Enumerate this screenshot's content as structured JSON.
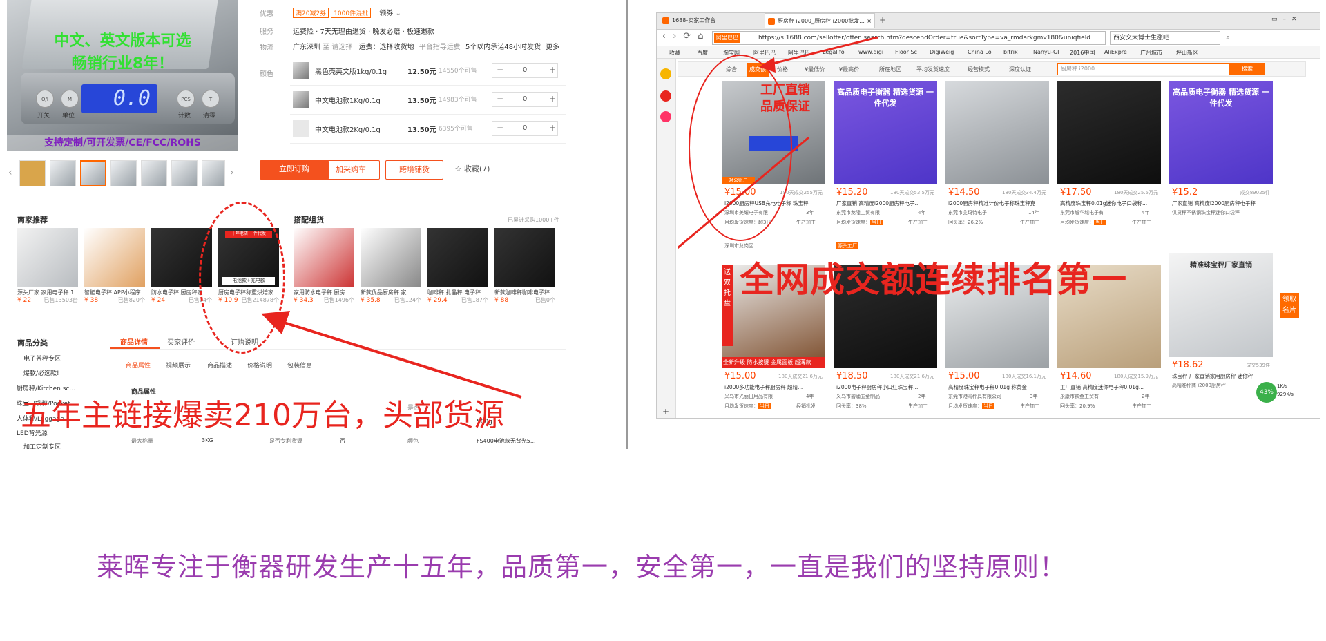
{
  "left_panel": {
    "image_overlay_line1": "中文、英文版本可选",
    "image_overlay_line2": "畅销行业8年！",
    "image_display": "0.0",
    "image_buttons": [
      "开关",
      "单位",
      "计数",
      "清零"
    ],
    "image_button_caps": [
      "O/I",
      "M",
      "PCS",
      "T"
    ],
    "image_bottom_banner": "支持定制/可开发票/CE/FCC/ROHS",
    "offer": {
      "promo_label": "优惠",
      "promo_tags": [
        "满20减2券",
        "1000件混批"
      ],
      "promo_more": "领券",
      "service_label": "服务",
      "service_value": "运费险 · 7天无理由退货 · 晚发必赔 · 极速退款",
      "logistics_label": "物流",
      "logistics_from": "广东深圳",
      "logistics_to": "至 请选择",
      "logistics_freight": "运费：选择收货地",
      "logistics_note": "平台指导运费",
      "logistics_ship": "5个以内承诺48小时发货",
      "logistics_more": "更多",
      "color_label": "颜色"
    },
    "skus": [
      {
        "name": "黑色壳英文版1kg/0.1g",
        "price": "12.50元",
        "stock": "14550个可售",
        "qty": "0"
      },
      {
        "name": "中文电池款1Kg/0.1g",
        "price": "13.50元",
        "stock": "14983个可售",
        "qty": "0"
      },
      {
        "name": "中文电池款2Kg/0.1g",
        "price": "13.50元",
        "stock": "6395个可售",
        "qty": "0"
      }
    ],
    "stepper_minus": "−",
    "stepper_plus": "+",
    "buttons": {
      "order": "立即订购",
      "cart": "加采购车",
      "crossborder": "跨境铺货",
      "fav": "☆ 收藏(7)"
    },
    "merchant_rec_title": "商家推荐",
    "combo_title": "搭配组货",
    "combo_note": "已累计采购1000+件",
    "products": [
      {
        "name": "源头厂家 家用电子秤 1...",
        "price": "¥ 22",
        "sold": "已售13503台"
      },
      {
        "name": "智能电子秤 APP小程序...",
        "price": "¥ 38",
        "sold": "已售820个"
      },
      {
        "name": "防水电子秤 厨房秤家...",
        "price": "¥ 24",
        "sold": "已售24个"
      },
      {
        "name": "厨房电子秤称重烘焙家...",
        "price": "¥ 10.9",
        "sold": "已售214878个"
      },
      {
        "name": "家用防水电子秤 厨房...",
        "price": "¥ 34.3",
        "sold": "已售1496个"
      },
      {
        "name": "新款优品厨房秤 家...",
        "price": "¥ 35.8",
        "sold": "已售124个"
      },
      {
        "name": "咖啡秤 扎晶秤 电子秤...",
        "price": "¥ 29.4",
        "sold": "已售187个"
      },
      {
        "name": "新款咖啡秤咖啡电子秤...",
        "price": "¥ 88",
        "sold": "已售0个"
      }
    ],
    "product_badge": "电池款+充电款",
    "product_badge2": "十年老店 一件代发",
    "category_title": "商品分类",
    "categories": [
      "电子茶秤专区",
      "爆款/必选款!",
      "厨房秤/Kitchen sc...",
      "珠宝口袋秤/Pocket...",
      "人体秤/Luggage...",
      "LED背光源",
      "加工定制专区"
    ],
    "detail_tabs": [
      "商品详情",
      "买家评价",
      "订购说明"
    ],
    "sub_tabs": [
      "商品属性",
      "视频展示",
      "商品描述",
      "价格说明",
      "包装信息"
    ],
    "attr_title": "商品属性",
    "attrs": [
      {
        "k": "最大称量",
        "v": "3KG"
      },
      {
        "k": "是否专利货源",
        "v": "否"
      },
      {
        "k": "颜色",
        "v": "FS400电池款无背光5..."
      }
    ],
    "attr_fragment": "是否",
    "attr_fragment2": "500g",
    "overlay_caption": "五年主链接爆卖210万台，头部货源"
  },
  "browser": {
    "tabs": [
      "1688-卖家工作台",
      "厨房秤 i2000_厨房秤 i2000批发..."
    ],
    "url": "https://s.1688.com/selloffer/offer_search.htm?descendOrder=true&sortType=va_rmdarkgmv180&uniqfield",
    "address_badge": "阿里巴巴",
    "search_engine_text": "西安交大博士生涨吧",
    "bookmarks": [
      "收藏",
      "百度",
      "淘宝网",
      "阿里巴巴",
      "阿里巴巴",
      "Legal fo",
      "www.digi",
      "Floor Sc",
      "DigiWeig",
      "China Lo",
      "bitrix",
      "Nanyu-GI",
      "2016中国",
      "AliExpre",
      "广州城市",
      "坪山新区"
    ],
    "filters": [
      "综合",
      "成交额",
      "价格",
      "¥最低价",
      "¥最高价",
      "所在地区",
      "平均发货速度",
      "经营模式",
      "深度认证"
    ],
    "search_value": "厨房秤 i2000",
    "search_button": "搜索",
    "overlay_factory1": "工厂直销",
    "overlay_factory2": "品质保证",
    "overlay_rank": "全网成交额连续排名第一",
    "side_labels": [
      "领取",
      "名片"
    ],
    "speed": "43%",
    "speed_up": "1K/s",
    "speed_down": "929K/s",
    "cards": [
      {
        "price": "¥15.00",
        "sold": "180天成交255万元",
        "title": "i2000厨房秤USB充电电子称 珠宝秤",
        "co": "深圳市美耀电子有限",
        "yrs": "3年",
        "speed": "超3日",
        "mode": "生产加工",
        "head": "",
        "tag": "对公账户",
        "region": "深圳市龙岗区"
      },
      {
        "price": "¥15.20",
        "sold": "180天成交53.5万元",
        "title": "厂家直销 高精度i2000厨房秤电子...",
        "co": "东莞市龙隆工贸有限",
        "yrs": "4年",
        "speed": "当日",
        "mode": "生产加工",
        "head": "高品质电子衡器 精选货源 一件代发",
        "tag": "",
        "region": "源头工厂"
      },
      {
        "price": "¥14.50",
        "sold": "180天成交34.4万元",
        "title": "i2000厨房秤精准计价电子称珠宝秤克",
        "co": "东莞市艾玛特电子",
        "yrs": "14年",
        "speed": "26.2%",
        "mode": "生产加工",
        "head": "",
        "tag": "",
        "region": ""
      },
      {
        "price": "¥17.50",
        "sold": "180天成交25.5万元",
        "title": "高精度珠宝秤0.01g迷你电子口袋称...",
        "co": "东莞市城华城电子有",
        "yrs": "4年",
        "speed": "当日",
        "mode": "生产加工",
        "head": "",
        "tag": "",
        "region": ""
      },
      {
        "price": "¥15.2",
        "sold": "成交89025件",
        "title": "厂家直销 高精度i2000厨房秤电子秤",
        "co": "供货秤不锈钢珠宝秤迷你口袋秤",
        "yrs": "",
        "speed": "",
        "mode": "",
        "head": "高品质电子衡器 精选货源 一件代发",
        "tag": "",
        "region": ""
      },
      {
        "price": "¥15.00",
        "sold": "180天成交21.6万元",
        "title": "i2000多功能电子秤厨房秤 超精...",
        "co": "义乌市光丽日用品有限",
        "yrs": "4年",
        "speed": "当日",
        "mode": "经销批发",
        "head": "",
        "tag": "",
        "region": ""
      },
      {
        "price": "¥18.50",
        "sold": "180天成交21.6万元",
        "title": "i2000电子秤厨房秤小口红珠宝秤...",
        "co": "义乌市碧涌五金制品",
        "yrs": "2年",
        "speed": "38%",
        "mode": "生产加工",
        "head": "",
        "tag": "",
        "region": ""
      },
      {
        "price": "¥15.00",
        "sold": "180天成交16.1万元",
        "title": "高精度珠宝秤电子秤0.01g 称黄金",
        "co": "东莞市港湾秤具有限公司",
        "yrs": "3年",
        "speed": "当日",
        "mode": "生产加工",
        "head": "",
        "tag": "",
        "region": ""
      },
      {
        "price": "¥14.60",
        "sold": "180天成交15.9万元",
        "title": "工厂直销 高精度迷你电子秤0.01g...",
        "co": "永康市铁金工贸有",
        "yrs": "2年",
        "speed": "20.9%",
        "mode": "生产加工",
        "head": "",
        "tag": "",
        "region": ""
      },
      {
        "price": "¥18.62",
        "sold": "成交539件",
        "title": "珠宝秤 厂家直销家用厨房秤 迷你秤",
        "co": "高精准秤商 i2000厨房秤",
        "yrs": "",
        "speed": "",
        "mode": "",
        "head": "精准珠宝秤厂家直销",
        "tag": "",
        "region": ""
      }
    ],
    "card_labels": {
      "speed_label": "月均发货速度：",
      "repeat_label": "回头率："
    },
    "card_promo_text": [
      "全新升级",
      "防水按键",
      "金属面板",
      "超薄款"
    ],
    "card_side_banner": [
      "送",
      "双",
      "托",
      "盘"
    ]
  },
  "bottom_caption": "莱晖专注于衡器研发生产十五年，品质第一，安全第一，一直是我们的坚持原则！"
}
